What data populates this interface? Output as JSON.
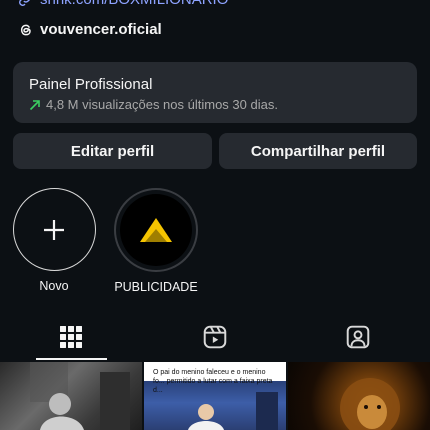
{
  "bio": {
    "link_text": "snnk.com/BOXMILIONARIO",
    "threads_handle": "vouvencer.oficial"
  },
  "professional_panel": {
    "title": "Painel Profissional",
    "stats": "4,8 M visualizações nos últimos 30 dias."
  },
  "buttons": {
    "edit": "Editar perfil",
    "share": "Compartilhar perfil"
  },
  "highlights": [
    {
      "label": "Novo"
    },
    {
      "label": "PUBLICIDADE"
    }
  ],
  "tabs": {
    "icons": [
      "grid-icon",
      "reels-icon",
      "tagged-icon"
    ],
    "active": "grid"
  },
  "posts": [
    {
      "caption": ""
    },
    {
      "caption": "O pai do menino faleceu e o menino fo... permitido a lutar com a faixa preta d..."
    },
    {
      "caption": ""
    }
  ],
  "colors": {
    "background": "#0c1014",
    "panel": "#262a30",
    "link": "#8ea3ff",
    "trend_arrow": "#3ccf62",
    "brand_yellow": "#f5c400"
  }
}
